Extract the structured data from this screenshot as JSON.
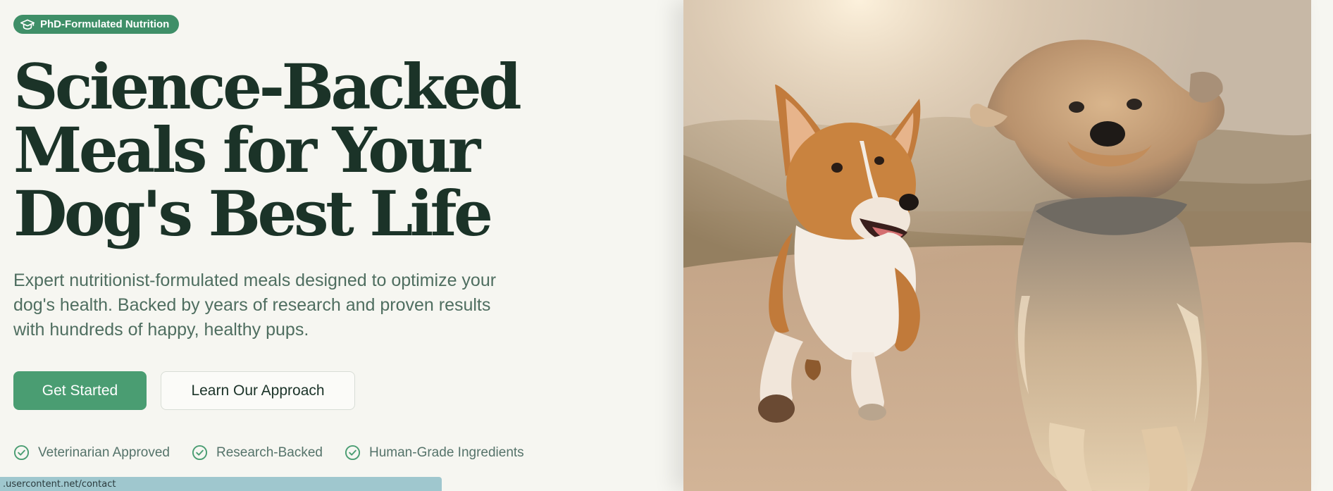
{
  "badge": {
    "icon": "graduation-cap-icon",
    "label": "PhD-Formulated Nutrition"
  },
  "headline": {
    "lines": [
      "Science-Backed",
      "Meals for Your",
      "Dog's Best Life"
    ]
  },
  "subtitle": {
    "lines": [
      "Expert nutritionist-formulated meals designed to optimize your",
      "dog's health. Backed by years of research and proven results",
      "with hundreds of happy, healthy pups."
    ]
  },
  "buttons": {
    "primary": "Get Started",
    "secondary": "Learn Our Approach"
  },
  "trust": [
    {
      "icon": "check-circle-icon",
      "label": "Veterinarian Approved"
    },
    {
      "icon": "check-circle-icon",
      "label": "Research-Backed"
    },
    {
      "icon": "check-circle-icon",
      "label": "Human-Grade Ingredients"
    }
  ],
  "status_url": ".usercontent.net/contact",
  "colors": {
    "accent": "#4a9d72",
    "heading": "#1b3328",
    "body_text": "#4f6e60",
    "background": "#f6f6f1"
  }
}
